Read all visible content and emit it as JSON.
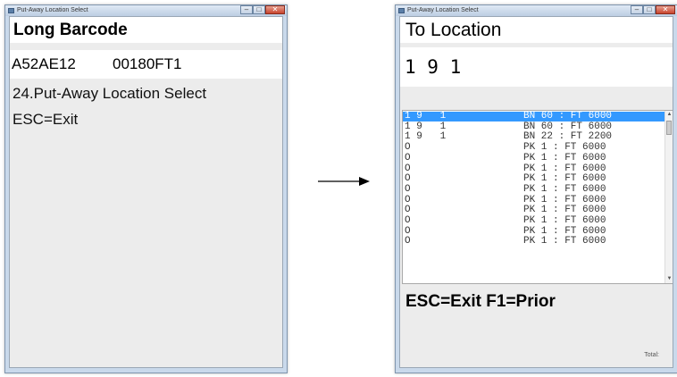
{
  "left_window": {
    "title": "Put-Away Location Select",
    "header": "Long Barcode",
    "barcode_part1": "A52AE12",
    "barcode_part2": "00180FT1",
    "function_line": "24.Put-Away Location Select",
    "exit_hint": "ESC=Exit"
  },
  "right_window": {
    "title": "Put-Away Location Select",
    "header": "To Location",
    "location_value": "1 9 1",
    "list": [
      {
        "loc": "1 9   1",
        "detail": "BN 60 : FT 6000",
        "selected": true
      },
      {
        "loc": "1 9   1",
        "detail": "BN 60 : FT 6000",
        "selected": false
      },
      {
        "loc": "1 9   1",
        "detail": "BN 22 : FT 2200",
        "selected": false
      },
      {
        "loc": "O",
        "detail": "PK 1 : FT 6000",
        "selected": false
      },
      {
        "loc": "O",
        "detail": "PK 1 : FT 6000",
        "selected": false
      },
      {
        "loc": "O",
        "detail": "PK 1 : FT 6000",
        "selected": false
      },
      {
        "loc": "O",
        "detail": "PK 1 : FT 6000",
        "selected": false
      },
      {
        "loc": "O",
        "detail": "PK 1 : FT 6000",
        "selected": false
      },
      {
        "loc": "O",
        "detail": "PK 1 : FT 6000",
        "selected": false
      },
      {
        "loc": "O",
        "detail": "PK 1 : FT 6000",
        "selected": false
      },
      {
        "loc": "O",
        "detail": "PK 1 : FT 6000",
        "selected": false
      },
      {
        "loc": "O",
        "detail": "PK 1 : FT 6000",
        "selected": false
      },
      {
        "loc": "O",
        "detail": "PK 1 : FT 6000",
        "selected": false
      }
    ],
    "footer": "ESC=Exit F1=Prior",
    "total_label": "Total:"
  },
  "colors": {
    "selection": "#3399ff",
    "window_frame": "#c9d9eb",
    "client_bg": "#ececec"
  },
  "icons": [
    "app-icon",
    "minimize-icon",
    "maximize-icon",
    "close-icon",
    "right-arrow-icon"
  ]
}
